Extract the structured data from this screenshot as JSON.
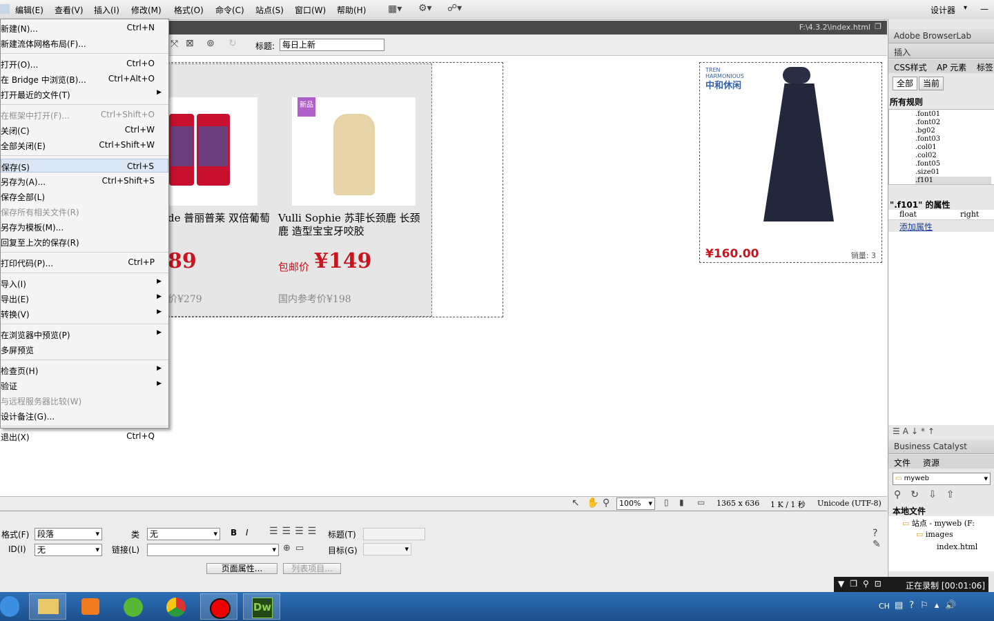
{
  "menubar": {
    "items": [
      "编辑(E)",
      "查看(V)",
      "插入(I)",
      "修改(M)",
      "格式(O)",
      "命令(C)",
      "站点(S)",
      "窗口(W)",
      "帮助(H)"
    ],
    "workspace": "设计器"
  },
  "file_menu": {
    "items": [
      {
        "label": "新建(N)...",
        "shortcut": "Ctrl+N"
      },
      {
        "label": "新建流体网格布局(F)...",
        "shortcut": ""
      },
      {
        "label": "打开(O)...",
        "shortcut": "Ctrl+O"
      },
      {
        "label": "在 Bridge 中浏览(B)...",
        "shortcut": "Ctrl+Alt+O"
      },
      {
        "label": "打开最近的文件(T)",
        "shortcut": "",
        "submenu": true
      },
      {
        "label": "在框架中打开(F)...",
        "shortcut": "Ctrl+Shift+O",
        "disabled": true
      },
      {
        "label": "关闭(C)",
        "shortcut": "Ctrl+W"
      },
      {
        "label": "全部关闭(E)",
        "shortcut": "Ctrl+Shift+W"
      },
      {
        "label": "保存(S)",
        "shortcut": "Ctrl+S",
        "highlight": true
      },
      {
        "label": "另存为(A)...",
        "shortcut": "Ctrl+Shift+S"
      },
      {
        "label": "保存全部(L)",
        "shortcut": ""
      },
      {
        "label": "保存所有相关文件(R)",
        "shortcut": "",
        "disabled": true
      },
      {
        "label": "另存为模板(M)...",
        "shortcut": ""
      },
      {
        "label": "回复至上次的保存(R)",
        "shortcut": ""
      },
      {
        "label": "打印代码(P)...",
        "shortcut": "Ctrl+P"
      },
      {
        "label": "导入(I)",
        "shortcut": "",
        "submenu": true
      },
      {
        "label": "导出(E)",
        "shortcut": "",
        "submenu": true
      },
      {
        "label": "转换(V)",
        "shortcut": "",
        "submenu": true
      },
      {
        "label": "在浏览器中预览(P)",
        "shortcut": "",
        "submenu": true
      },
      {
        "label": "多屏预览",
        "shortcut": ""
      },
      {
        "label": "检查页(H)",
        "shortcut": "",
        "submenu": true
      },
      {
        "label": "验证",
        "shortcut": "",
        "submenu": true
      },
      {
        "label": "与远程服务器比较(W)",
        "shortcut": "",
        "disabled": true
      },
      {
        "label": "设计备注(G)...",
        "shortcut": ""
      },
      {
        "label": "退出(X)",
        "shortcut": "Ctrl+Q"
      }
    ]
  },
  "document": {
    "path": "F:\\4.3.2\\index.html",
    "title_label": "标题:",
    "title_value": "每日上新"
  },
  "products": [
    {
      "name": "de 普丽普莱 双倍葡萄 囊 100粒/瓶 2瓶",
      "price": "89",
      "ref": "价¥279",
      "badge": ""
    },
    {
      "name": "Vulli Sophie 苏菲长颈鹿 长颈鹿 造型宝宝牙咬胶",
      "price_prefix": "包邮价",
      "price": "¥149",
      "ref": "国内参考价¥198",
      "badge": "新品"
    }
  ],
  "ad": {
    "brand_top": "TREN HARMONIOUS",
    "brand": "中和休闲",
    "price": "¥160.00",
    "sales": "销量: 3"
  },
  "right_panel": {
    "browserlab": "Adobe BrowserLab",
    "insert": "插入",
    "tabs": [
      "CSS样式",
      "AP 元素",
      "标签"
    ],
    "modes": [
      "全部",
      "当前"
    ],
    "all_rules": "所有规则",
    "rules": [
      ".font01",
      ".font02",
      ".bg02",
      ".font03",
      ".col01",
      ".col02",
      ".font05",
      ".size01",
      ".f101"
    ],
    "props_title": "\".f101\" 的属性",
    "prop_name": "float",
    "prop_value": "right",
    "add_prop": "添加属性",
    "bc": "Business Catalyst",
    "file_tabs": [
      "文件",
      "资源"
    ],
    "site_select": "myweb",
    "local_files": "本地文件",
    "tree": [
      "站点 - myweb (F:",
      "images",
      "index.html"
    ]
  },
  "statusbar": {
    "zoom": "100%",
    "dims": "1365 x 636",
    "size": "1 K / 1 秒",
    "encoding": "Unicode (UTF-8)"
  },
  "props": {
    "format_label": "格式(F)",
    "format_value": "段落",
    "class_label": "类",
    "class_value": "无",
    "id_label": "ID(I)",
    "id_value": "无",
    "link_label": "链接(L)",
    "title_label": "标题(T)",
    "target_label": "目标(G)",
    "page_props": "页面属性...",
    "list_item": "列表项目..."
  },
  "recording": {
    "label": "正在录制 [00:01:06]"
  },
  "taskbar": {
    "lang": "CH"
  }
}
